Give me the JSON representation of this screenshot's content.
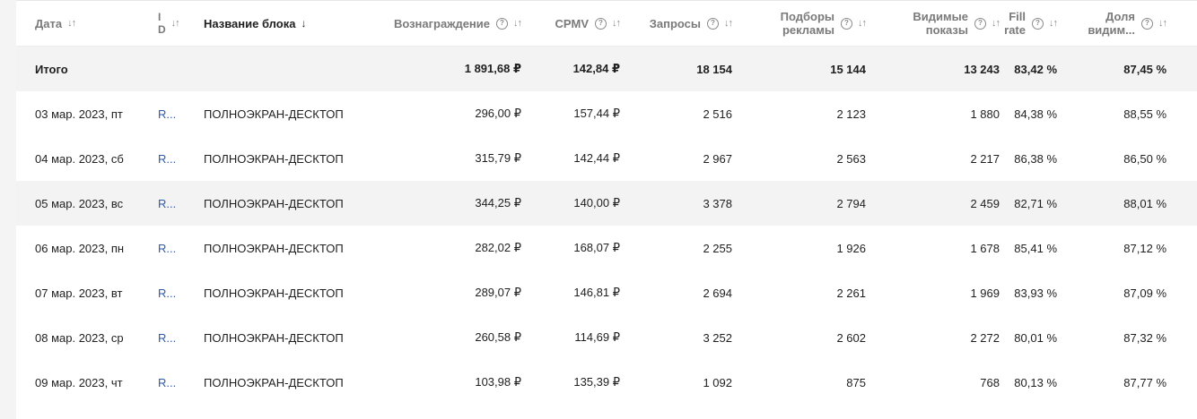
{
  "headers": {
    "date": "Дата",
    "id": [
      "I",
      "D"
    ],
    "name": "Название блока",
    "reward": "Вознаграждение",
    "cpmv": "CPMV",
    "requests": "Запросы",
    "matches": [
      "Подборы",
      "рекламы"
    ],
    "visible": [
      "Видимые",
      "показы"
    ],
    "fillrate": [
      "Fill",
      "rate"
    ],
    "share": [
      "Доля",
      "видим..."
    ]
  },
  "icons": {
    "sort": "sort-arrows-icon",
    "sort_down": "sort-down-icon",
    "info": "info-icon"
  },
  "total": {
    "label": "Итого",
    "reward": "1 891,68 ₽",
    "cpmv": "142,84 ₽",
    "requests": "18 154",
    "matches": "15 144",
    "visible": "13 243",
    "fillrate": "83,42 %",
    "share": "87,45 %"
  },
  "rows": [
    {
      "date": "03 мар. 2023, пт",
      "id": "R...",
      "name": "ПОЛНОЭКРАН-ДЕСКТОП",
      "reward": "296,00 ₽",
      "cpmv": "157,44 ₽",
      "requests": "2 516",
      "matches": "2 123",
      "visible": "1 880",
      "fillrate": "84,38 %",
      "share": "88,55 %"
    },
    {
      "date": "04 мар. 2023, сб",
      "id": "R...",
      "name": "ПОЛНОЭКРАН-ДЕСКТОП",
      "reward": "315,79 ₽",
      "cpmv": "142,44 ₽",
      "requests": "2 967",
      "matches": "2 563",
      "visible": "2 217",
      "fillrate": "86,38 %",
      "share": "86,50 %"
    },
    {
      "date": "05 мар. 2023, вс",
      "id": "R...",
      "name": "ПОЛНОЭКРАН-ДЕСКТОП",
      "reward": "344,25 ₽",
      "cpmv": "140,00 ₽",
      "requests": "3 378",
      "matches": "2 794",
      "visible": "2 459",
      "fillrate": "82,71 %",
      "share": "88,01 %"
    },
    {
      "date": "06 мар. 2023, пн",
      "id": "R...",
      "name": "ПОЛНОЭКРАН-ДЕСКТОП",
      "reward": "282,02 ₽",
      "cpmv": "168,07 ₽",
      "requests": "2 255",
      "matches": "1 926",
      "visible": "1 678",
      "fillrate": "85,41 %",
      "share": "87,12 %"
    },
    {
      "date": "07 мар. 2023, вт",
      "id": "R...",
      "name": "ПОЛНОЭКРАН-ДЕСКТОП",
      "reward": "289,07 ₽",
      "cpmv": "146,81 ₽",
      "requests": "2 694",
      "matches": "2 261",
      "visible": "1 969",
      "fillrate": "83,93 %",
      "share": "87,09 %"
    },
    {
      "date": "08 мар. 2023, ср",
      "id": "R...",
      "name": "ПОЛНОЭКРАН-ДЕСКТОП",
      "reward": "260,58 ₽",
      "cpmv": "114,69 ₽",
      "requests": "3 252",
      "matches": "2 602",
      "visible": "2 272",
      "fillrate": "80,01 %",
      "share": "87,32 %"
    },
    {
      "date": "09 мар. 2023, чт",
      "id": "R...",
      "name": "ПОЛНОЭКРАН-ДЕСКТОП",
      "reward": "103,98 ₽",
      "cpmv": "135,39 ₽",
      "requests": "1 092",
      "matches": "875",
      "visible": "768",
      "fillrate": "80,13 %",
      "share": "87,77 %"
    }
  ]
}
